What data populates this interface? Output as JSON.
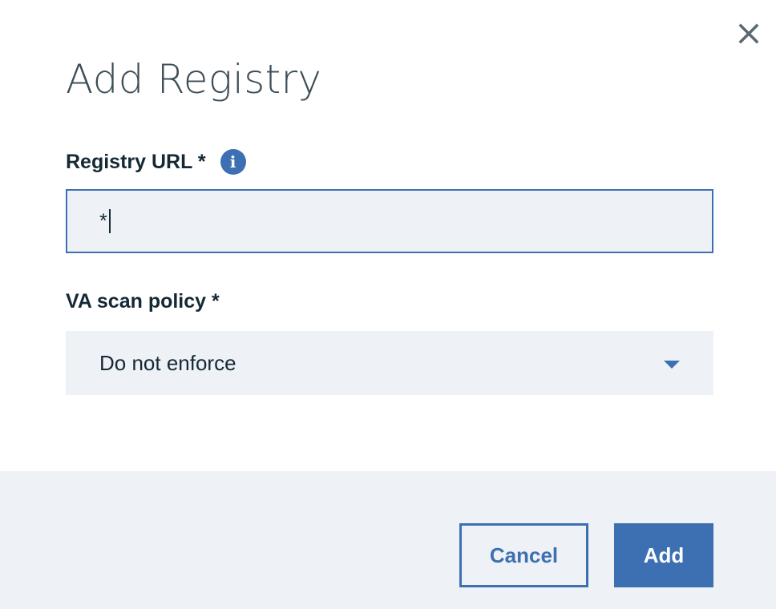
{
  "modal": {
    "title": "Add Registry",
    "close_icon": "close-icon"
  },
  "form": {
    "registry_url": {
      "label": "Registry URL *",
      "info_icon": "info-icon",
      "info_glyph": "i",
      "value": "*"
    },
    "va_scan_policy": {
      "label": "VA scan policy *",
      "selected": "Do not enforce",
      "dropdown_icon": "chevron-down-icon"
    }
  },
  "footer": {
    "cancel_label": "Cancel",
    "add_label": "Add"
  },
  "colors": {
    "accent": "#3d70b2",
    "field_background": "#eef2f7",
    "footer_background": "#eef1f5",
    "text": "#152935",
    "title": "#3d4e58"
  }
}
